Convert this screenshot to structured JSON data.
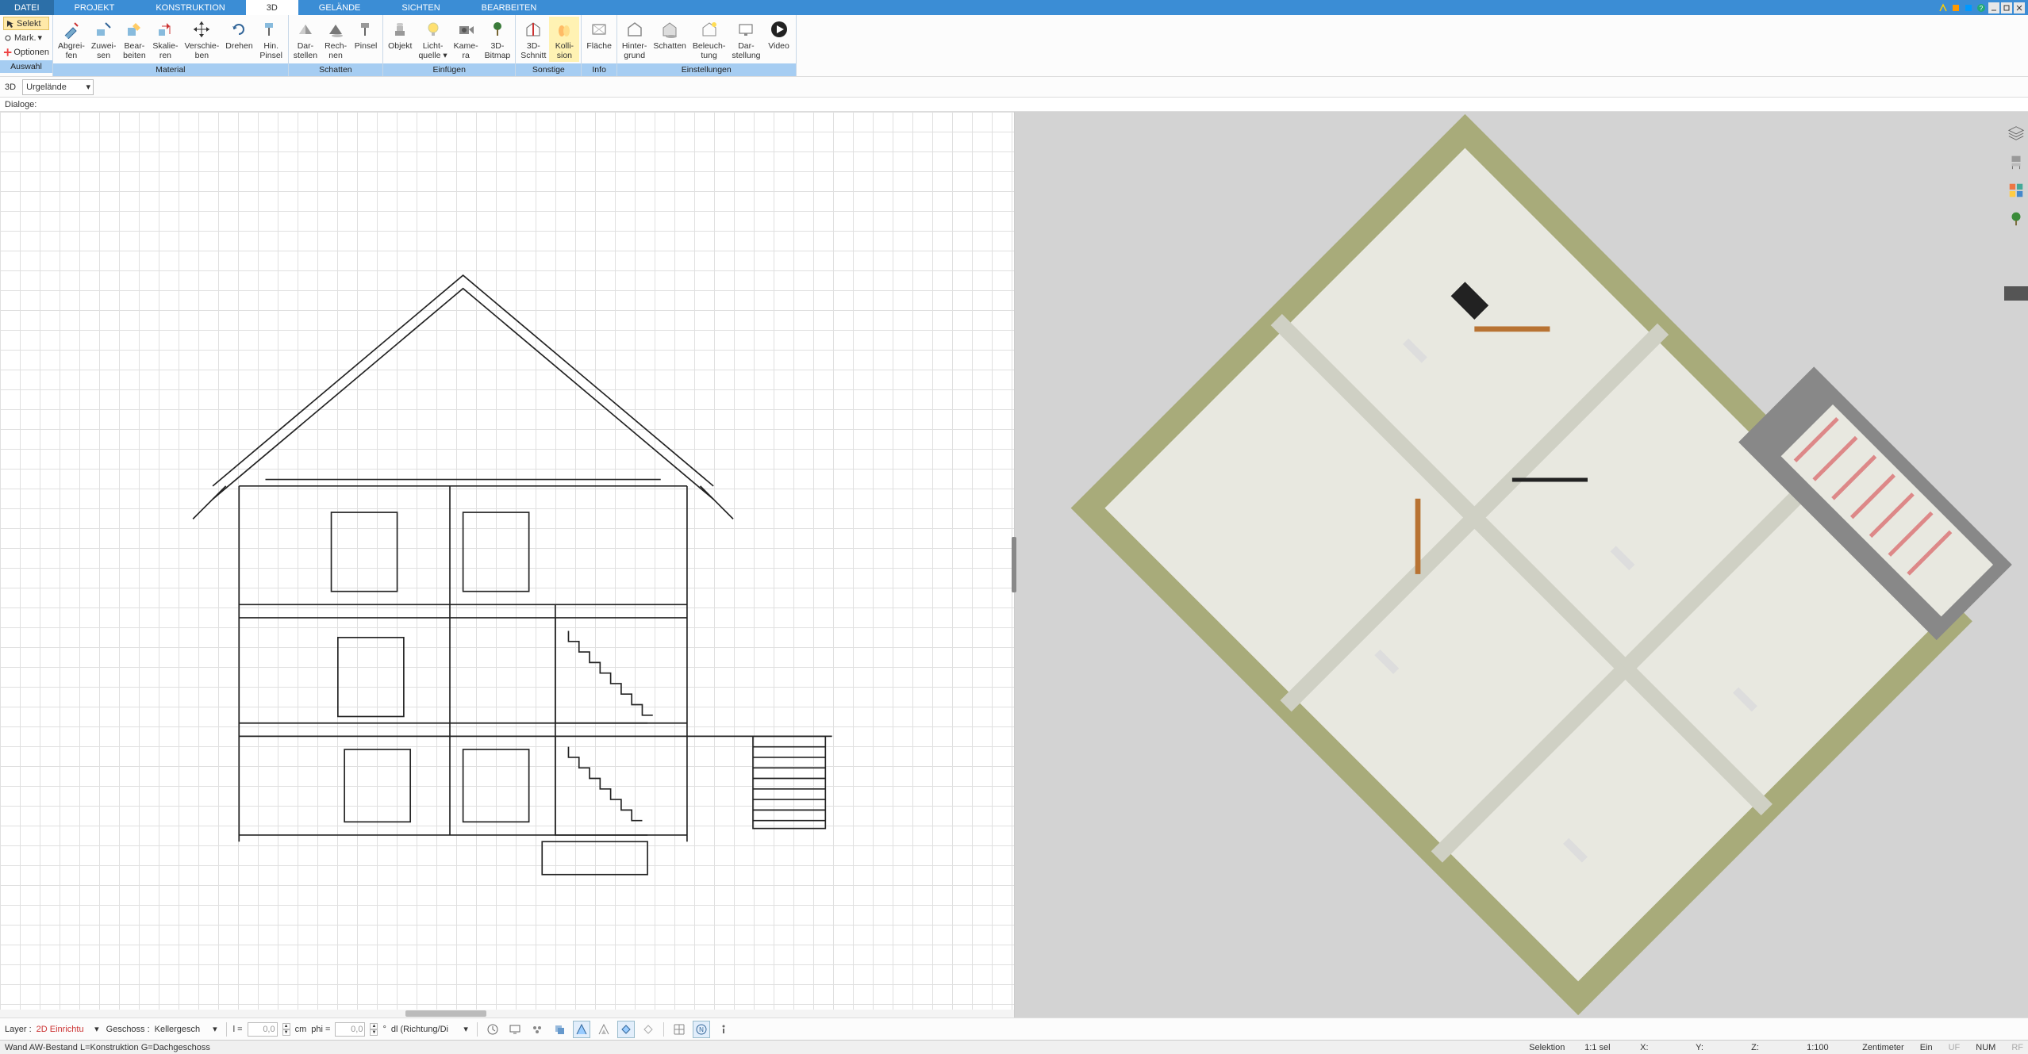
{
  "menu": {
    "tabs": [
      "DATEI",
      "PROJEKT",
      "KONSTRUKTION",
      "3D",
      "GELÄNDE",
      "SICHTEN",
      "BEARBEITEN"
    ],
    "active_index": 3
  },
  "ribbon": {
    "auswahl": {
      "selekt": "Selekt",
      "mark": "Mark.",
      "optionen": "Optionen",
      "label": "Auswahl"
    },
    "groups": [
      {
        "label": "Material",
        "buttons": [
          {
            "id": "abgreifen",
            "label": "Abgrei-\nfen"
          },
          {
            "id": "zuweisen",
            "label": "Zuwei-\nsen"
          },
          {
            "id": "bearbeiten",
            "label": "Bear-\nbeiten"
          },
          {
            "id": "skalieren",
            "label": "Skalie-\nren"
          },
          {
            "id": "verschieben",
            "label": "Verschie-\nben"
          },
          {
            "id": "drehen",
            "label": "Drehen"
          },
          {
            "id": "hinpinsel",
            "label": "Hin.\nPinsel"
          }
        ]
      },
      {
        "label": "Schatten",
        "buttons": [
          {
            "id": "darstellen",
            "label": "Dar-\nstellen"
          },
          {
            "id": "rechnen",
            "label": "Rech-\nnen"
          },
          {
            "id": "pinsel",
            "label": "Pinsel"
          }
        ]
      },
      {
        "label": "Einfügen",
        "buttons": [
          {
            "id": "objekt",
            "label": "Objekt"
          },
          {
            "id": "lichtquelle",
            "label": "Licht-\nquelle ▾"
          },
          {
            "id": "kamera",
            "label": "Kame-\nra"
          },
          {
            "id": "bitmap3d",
            "label": "3D-\nBitmap"
          }
        ]
      },
      {
        "label": "Sonstige",
        "buttons": [
          {
            "id": "schnitt3d",
            "label": "3D-\nSchnitt"
          },
          {
            "id": "kollision",
            "label": "Kolli-\nsion",
            "hl": true
          }
        ]
      },
      {
        "label": "Info",
        "buttons": [
          {
            "id": "flaeche",
            "label": "Fläche"
          }
        ]
      },
      {
        "label": "Einstellungen",
        "buttons": [
          {
            "id": "hintergrund",
            "label": "Hinter-\ngrund"
          },
          {
            "id": "schatten-einst",
            "label": "Schatten"
          },
          {
            "id": "beleuchtung",
            "label": "Beleuch-\ntung"
          },
          {
            "id": "darstellung",
            "label": "Dar-\nstellung"
          },
          {
            "id": "video",
            "label": "Video"
          }
        ]
      }
    ]
  },
  "sub_toolbar": {
    "mode": "3D",
    "layer_combo": "Urgelände"
  },
  "dialoge": {
    "label": "Dialoge:"
  },
  "bottom": {
    "layer_label": "Layer :",
    "layer_value": "2D Einrichtu",
    "geschoss_label": "Geschoss :",
    "geschoss_value": "Kellergesch",
    "l_label": "l =",
    "l_value": "0,0",
    "l_unit": "cm",
    "phi_label": "phi =",
    "phi_value": "0,0",
    "phi_unit": "°",
    "dl_value": "dl (Richtung/Di"
  },
  "status": {
    "left": "Wand AW-Bestand L=Konstruktion G=Dachgeschoss",
    "selektion": "Selektion",
    "sel_ratio": "1:1 sel",
    "x": "X:",
    "y": "Y:",
    "z": "Z:",
    "scale": "1:100",
    "unit": "Zentimeter",
    "ein": "Ein",
    "uf": "UF",
    "num": "NUM",
    "rf": "RF"
  }
}
